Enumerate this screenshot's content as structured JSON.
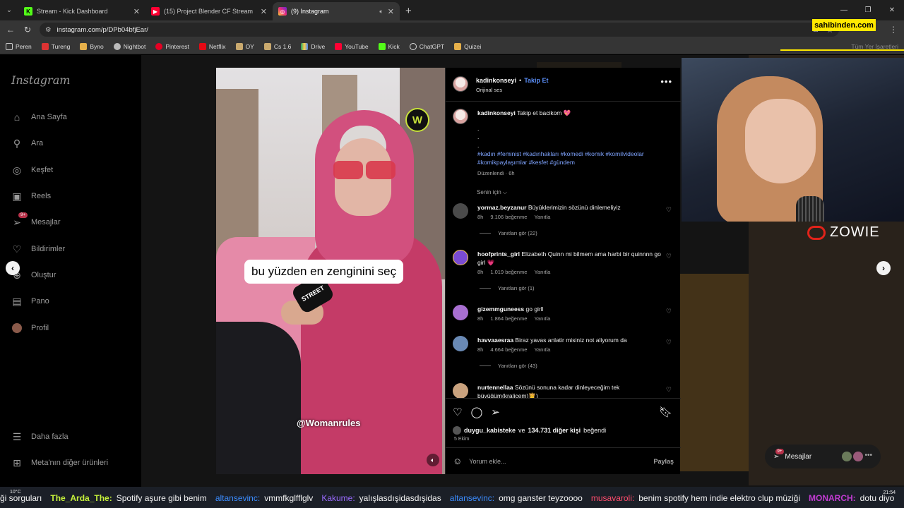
{
  "browser": {
    "tabs": [
      {
        "title": "Stream - Kick Dashboard",
        "fav_color": "#53fc18",
        "fav_glyph": "K"
      },
      {
        "title": "(15) Project Blender CF Stream",
        "fav_color": "#ff0033",
        "fav_glyph": "▶"
      },
      {
        "title": "(9) Instagram",
        "fav_color": "#d62976",
        "fav_glyph": "◎",
        "active": true
      }
    ],
    "url": "instagram.com/p/DPb04bfjEar/",
    "bookmarks": [
      "Peren",
      "Tureng",
      "Byno",
      "Nightbot",
      "Pinterest",
      "Netflix",
      "OY",
      "Cs 1.6",
      "Drive",
      "YouTube",
      "Kick",
      "ChatGPT",
      "Quizei"
    ],
    "bookmarks_all": "Tüm Yer İşaretleri"
  },
  "overlay": {
    "sahibinden": "sahibinden.com",
    "zowie": "ZOWIE"
  },
  "sidebar": {
    "logo": "Instagram",
    "items": [
      {
        "label": "Ana Sayfa",
        "icon": "home-icon"
      },
      {
        "label": "Ara",
        "icon": "search-icon"
      },
      {
        "label": "Keşfet",
        "icon": "compass-icon"
      },
      {
        "label": "Reels",
        "icon": "reels-icon"
      },
      {
        "label": "Mesajlar",
        "icon": "messages-icon",
        "badge": "9+"
      },
      {
        "label": "Bildirimler",
        "icon": "heart-icon"
      },
      {
        "label": "Oluştur",
        "icon": "plus-icon"
      },
      {
        "label": "Pano",
        "icon": "dashboard-icon"
      },
      {
        "label": "Profil",
        "icon": "avatar"
      }
    ],
    "more": "Daha fazla",
    "meta": "Meta'nın diğer ürünleri"
  },
  "video": {
    "caption": "bu yüzden en zenginini seç",
    "watermark": "@Womanrules",
    "badge": "W",
    "mic_label": "STREET"
  },
  "post": {
    "username": "kadinkonseyi",
    "follow": "Takip Et",
    "audio": "Orijinal ses",
    "caption_user": "kadinkonseyi",
    "caption_text": "Takip et bacikom 💖",
    "caption_dots": [
      ".",
      ".",
      "."
    ],
    "hashtags": "#kadın #feminist #kadınhakları #komedi #komik #komilvideolar #komikpaylaşımlar #kesfet #gündem",
    "edited": "Düzenlendi · 6h",
    "for_you": "Senin için",
    "comments": [
      {
        "user": "yormaz.beyzanur",
        "text": "Büyüklerimizin sözünü dinlemeliyiz",
        "time": "8h",
        "likes": "9.106 beğenme",
        "reply": "Yanıtla",
        "replies": "Yanıtları gör (22)",
        "color": "#4a4a4a"
      },
      {
        "user": "hoofprints_girl",
        "text": "Elizabeth Quinn mi bilmem ama harbi bir quinnnn go girl 💗",
        "time": "8h",
        "likes": "1.019 beğenme",
        "reply": "Yanıtla",
        "replies": "Yanıtları gör (1)",
        "color": "#7a4bd1"
      },
      {
        "user": "gizemmguneess",
        "text": "go girll",
        "time": "8h",
        "likes": "1.864 beğenme",
        "reply": "Yanıtla",
        "replies": "",
        "color": "#a86fd1"
      },
      {
        "user": "havvaaesraa",
        "text": "Biraz yavas anlatir misiniz not aliyorum da",
        "time": "8h",
        "likes": "4.664 beğenme",
        "reply": "Yanıtla",
        "replies": "Yanıtları gör (43)",
        "color": "#6a8ab5"
      },
      {
        "user": "nurtennellaa",
        "text": "Sözünü sonuna kadar dinleyeceğim tek büyüğüm(kraliçem)👸)",
        "time": "",
        "likes": "",
        "reply": "",
        "replies": "",
        "color": "#c9a27e"
      }
    ],
    "liked_by_user": "duygu_kabisteke",
    "liked_mid": "ve",
    "liked_others": "134.731 diğer kişi",
    "liked_suffix": "beğendi",
    "date": "5 Ekim",
    "add_comment": "Yorum ekle...",
    "share": "Paylaş"
  },
  "messages_pill": {
    "label": "Mesajlar",
    "badge": "9+"
  },
  "ticker": {
    "weather": "10°C",
    "time": "21:54",
    "items": [
      {
        "name": "",
        "msg": "ği sorguları"
      },
      {
        "name": "The_Arda_The:",
        "msg": "Spotify aşure gibi benim",
        "cls": "n1"
      },
      {
        "name": "altansevinc:",
        "msg": "vmmfkglfflglv",
        "cls": "n2"
      },
      {
        "name": "Kakume:",
        "msg": "yalışlasdışidasdışidas",
        "cls": "n3"
      },
      {
        "name": "altansevinc:",
        "msg": "omg ganster teyzoooo",
        "cls": "n2"
      },
      {
        "name": "musavaroli:",
        "msg": "benim spotify hem indie elektro clup müziği",
        "cls": "n4"
      },
      {
        "name": "MONARCH:",
        "msg": "dotu diyo",
        "cls": "n5"
      }
    ]
  }
}
